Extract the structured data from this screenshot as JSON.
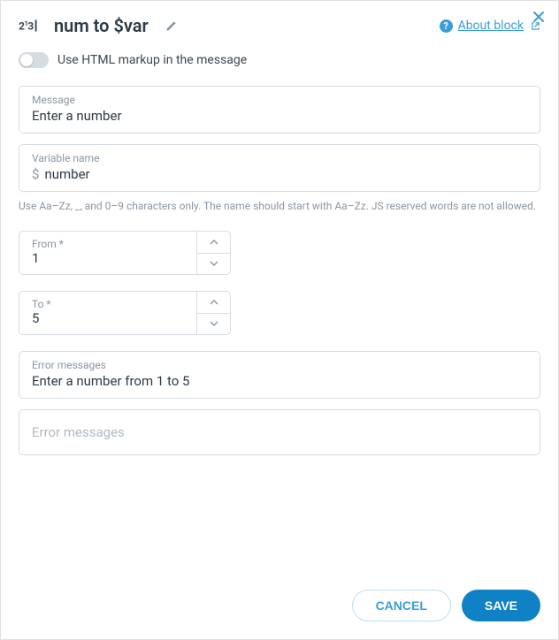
{
  "header": {
    "title": "num to $var",
    "about_label": "About block"
  },
  "toggle": {
    "label": "Use HTML markup in the message"
  },
  "message": {
    "label": "Message",
    "value": "Enter a number"
  },
  "variable": {
    "label": "Variable name",
    "value": "number",
    "hint": "Use Aa–Zz, _, and 0–9 characters only. The name should start with Aa–Zz. JS reserved words are not allowed."
  },
  "from": {
    "label": "From *",
    "value": "1"
  },
  "to": {
    "label": "To *",
    "value": "5"
  },
  "error1": {
    "label": "Error messages",
    "value": "Enter a number from 1 to 5"
  },
  "error2": {
    "placeholder": "Error messages"
  },
  "buttons": {
    "cancel": "CANCEL",
    "save": "SAVE"
  }
}
